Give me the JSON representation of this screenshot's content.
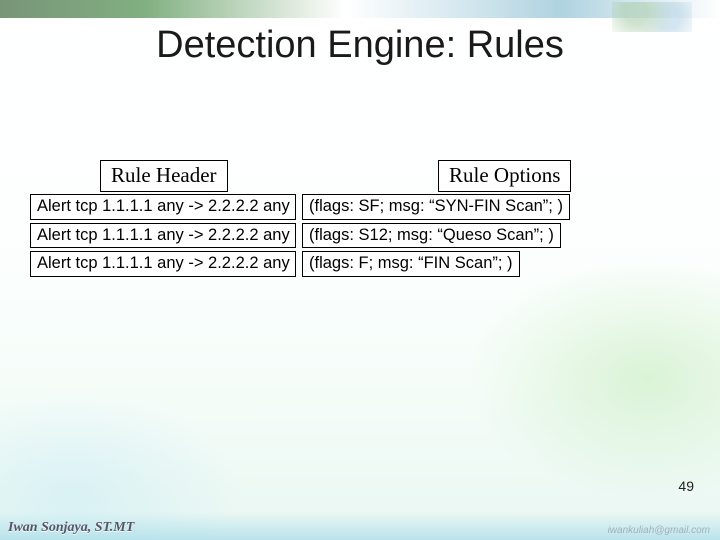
{
  "slide": {
    "title": "Detection Engine: Rules",
    "column_label_header": "Rule Header",
    "column_label_options": "Rule Options",
    "rules": [
      {
        "header": "Alert tcp 1.1.1.1 any -> 2.2.2.2 any",
        "options": "(flags: SF; msg: “SYN-FIN Scan”; )"
      },
      {
        "header": "Alert tcp 1.1.1.1 any -> 2.2.2.2 any",
        "options": "(flags: S12; msg: “Queso Scan”; )"
      },
      {
        "header": "Alert tcp 1.1.1.1 any -> 2.2.2.2 any",
        "options": "(flags: F; msg: “FIN Scan”; )"
      }
    ],
    "page_number": "49",
    "author": "Iwan Sonjaya, ST.MT",
    "email": "iwankuliah@gmail.com"
  }
}
